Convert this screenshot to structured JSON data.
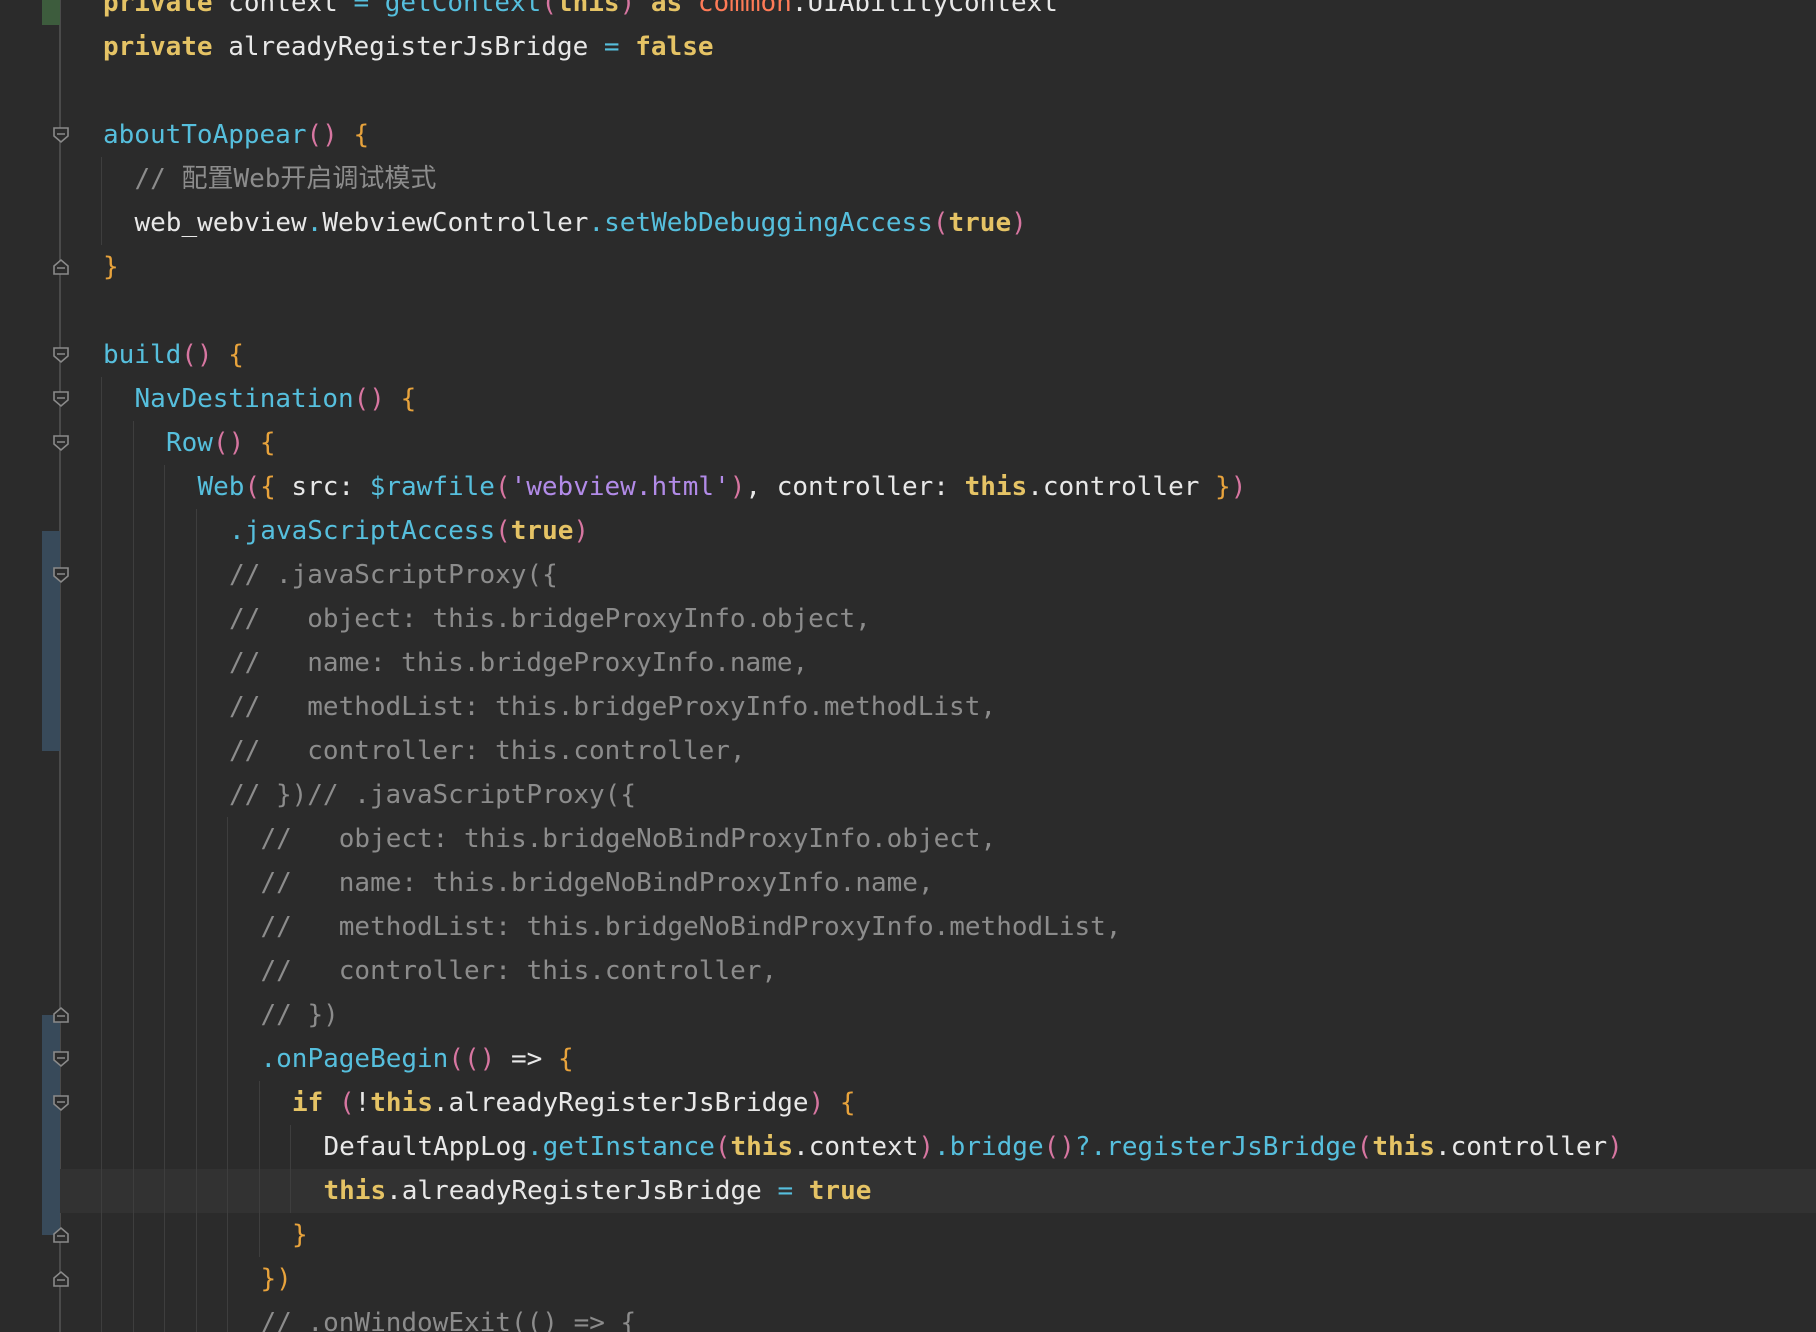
{
  "editor": {
    "lines": [
      {
        "indent": 0,
        "tokens": [
          {
            "t": "private",
            "c": "keyword"
          },
          {
            "t": " context ",
            "c": "default"
          },
          {
            "t": "=",
            "c": "op"
          },
          {
            "t": " getContext",
            "c": "fn"
          },
          {
            "t": "(",
            "c": "paren"
          },
          {
            "t": "this",
            "c": "keyword"
          },
          {
            "t": ")",
            "c": "paren"
          },
          {
            "t": " as ",
            "c": "keyword"
          },
          {
            "t": "common",
            "c": "type"
          },
          {
            "t": ".UIAbilityContext",
            "c": "default"
          }
        ]
      },
      {
        "indent": 0,
        "tokens": [
          {
            "t": "private",
            "c": "keyword"
          },
          {
            "t": " alreadyRegisterJsBridge ",
            "c": "default"
          },
          {
            "t": "=",
            "c": "op"
          },
          {
            "t": " false",
            "c": "keyword"
          }
        ]
      },
      {
        "indent": 0,
        "tokens": []
      },
      {
        "indent": 0,
        "tokens": [
          {
            "t": "aboutToAppear",
            "c": "fn"
          },
          {
            "t": "()",
            "c": "paren"
          },
          {
            "t": " {",
            "c": "brace"
          }
        ]
      },
      {
        "indent": 1,
        "tokens": [
          {
            "t": "// 配置Web开启调试模式",
            "c": "comment"
          }
        ]
      },
      {
        "indent": 1,
        "tokens": [
          {
            "t": "web_webview",
            "c": "default"
          },
          {
            "t": ".",
            "c": "dot"
          },
          {
            "t": "WebviewController",
            "c": "default"
          },
          {
            "t": ".",
            "c": "dot"
          },
          {
            "t": "setWebDebuggingAccess",
            "c": "fn"
          },
          {
            "t": "(",
            "c": "paren"
          },
          {
            "t": "true",
            "c": "keyword"
          },
          {
            "t": ")",
            "c": "paren"
          }
        ]
      },
      {
        "indent": 0,
        "tokens": [
          {
            "t": "}",
            "c": "brace"
          }
        ]
      },
      {
        "indent": 0,
        "tokens": []
      },
      {
        "indent": 0,
        "tokens": [
          {
            "t": "build",
            "c": "fn"
          },
          {
            "t": "()",
            "c": "paren"
          },
          {
            "t": " {",
            "c": "brace"
          }
        ]
      },
      {
        "indent": 1,
        "tokens": [
          {
            "t": "NavDestination",
            "c": "fn"
          },
          {
            "t": "()",
            "c": "paren"
          },
          {
            "t": " {",
            "c": "brace"
          }
        ]
      },
      {
        "indent": 2,
        "tokens": [
          {
            "t": "Row",
            "c": "fn"
          },
          {
            "t": "()",
            "c": "paren"
          },
          {
            "t": " {",
            "c": "brace"
          }
        ]
      },
      {
        "indent": 3,
        "tokens": [
          {
            "t": "Web",
            "c": "fn"
          },
          {
            "t": "(",
            "c": "paren"
          },
          {
            "t": "{",
            "c": "brace"
          },
          {
            "t": " src: ",
            "c": "default"
          },
          {
            "t": "$rawfile",
            "c": "fn"
          },
          {
            "t": "(",
            "c": "paren"
          },
          {
            "t": "'webview.html'",
            "c": "string"
          },
          {
            "t": ")",
            "c": "paren"
          },
          {
            "t": ", controller: ",
            "c": "default"
          },
          {
            "t": "this",
            "c": "keyword"
          },
          {
            "t": ".controller ",
            "c": "default"
          },
          {
            "t": "}",
            "c": "brace"
          },
          {
            "t": ")",
            "c": "paren"
          }
        ]
      },
      {
        "indent": 4,
        "tokens": [
          {
            "t": ".javaScriptAccess",
            "c": "fn"
          },
          {
            "t": "(",
            "c": "paren"
          },
          {
            "t": "true",
            "c": "keyword"
          },
          {
            "t": ")",
            "c": "paren"
          }
        ]
      },
      {
        "indent": 4,
        "tokens": [
          {
            "t": "// .javaScriptProxy({",
            "c": "comment"
          }
        ]
      },
      {
        "indent": 4,
        "tokens": [
          {
            "t": "//   object: this.bridgeProxyInfo.object,",
            "c": "comment"
          }
        ]
      },
      {
        "indent": 4,
        "tokens": [
          {
            "t": "//   name: this.bridgeProxyInfo.name,",
            "c": "comment"
          }
        ]
      },
      {
        "indent": 4,
        "tokens": [
          {
            "t": "//   methodList: this.bridgeProxyInfo.methodList,",
            "c": "comment"
          }
        ]
      },
      {
        "indent": 4,
        "tokens": [
          {
            "t": "//   controller: this.controller,",
            "c": "comment"
          }
        ]
      },
      {
        "indent": 4,
        "tokens": [
          {
            "t": "// })// .javaScriptProxy({",
            "c": "comment"
          }
        ]
      },
      {
        "indent": 5,
        "tokens": [
          {
            "t": "//   object: this.bridgeNoBindProxyInfo.object,",
            "c": "comment"
          }
        ]
      },
      {
        "indent": 5,
        "tokens": [
          {
            "t": "//   name: this.bridgeNoBindProxyInfo.name,",
            "c": "comment"
          }
        ]
      },
      {
        "indent": 5,
        "tokens": [
          {
            "t": "//   methodList: this.bridgeNoBindProxyInfo.methodList,",
            "c": "comment"
          }
        ]
      },
      {
        "indent": 5,
        "tokens": [
          {
            "t": "//   controller: this.controller,",
            "c": "comment"
          }
        ]
      },
      {
        "indent": 5,
        "tokens": [
          {
            "t": "// })",
            "c": "comment"
          }
        ]
      },
      {
        "indent": 5,
        "tokens": [
          {
            "t": ".onPageBegin",
            "c": "fn"
          },
          {
            "t": "(()",
            "c": "paren"
          },
          {
            "t": " => ",
            "c": "default"
          },
          {
            "t": "{",
            "c": "brace"
          }
        ]
      },
      {
        "indent": 6,
        "tokens": [
          {
            "t": "if",
            "c": "keyword"
          },
          {
            "t": " (",
            "c": "paren"
          },
          {
            "t": "!",
            "c": "default"
          },
          {
            "t": "this",
            "c": "keyword"
          },
          {
            "t": ".alreadyRegisterJsBridge",
            "c": "default"
          },
          {
            "t": ")",
            "c": "paren"
          },
          {
            "t": " {",
            "c": "brace"
          }
        ]
      },
      {
        "indent": 7,
        "tokens": [
          {
            "t": "DefaultAppLog",
            "c": "default"
          },
          {
            "t": ".",
            "c": "dot"
          },
          {
            "t": "getInstance",
            "c": "fn"
          },
          {
            "t": "(",
            "c": "paren"
          },
          {
            "t": "this",
            "c": "keyword"
          },
          {
            "t": ".context",
            "c": "default"
          },
          {
            "t": ")",
            "c": "paren"
          },
          {
            "t": ".",
            "c": "dot"
          },
          {
            "t": "bridge",
            "c": "fn"
          },
          {
            "t": "()",
            "c": "paren"
          },
          {
            "t": "?.",
            "c": "dot"
          },
          {
            "t": "registerJsBridge",
            "c": "fn"
          },
          {
            "t": "(",
            "c": "paren"
          },
          {
            "t": "this",
            "c": "keyword"
          },
          {
            "t": ".controller",
            "c": "default"
          },
          {
            "t": ")",
            "c": "paren"
          }
        ]
      },
      {
        "indent": 7,
        "tokens": [
          {
            "t": "this",
            "c": "keyword"
          },
          {
            "t": ".alreadyRegisterJsBridge ",
            "c": "default"
          },
          {
            "t": "=",
            "c": "op"
          },
          {
            "t": " true",
            "c": "keyword"
          }
        ]
      },
      {
        "indent": 6,
        "tokens": [
          {
            "t": "}",
            "c": "brace"
          }
        ]
      },
      {
        "indent": 5,
        "tokens": [
          {
            "t": "})",
            "c": "brace"
          }
        ]
      },
      {
        "indent": 5,
        "tokens": [
          {
            "t": "// .onWindowExit(() => {",
            "c": "comment"
          }
        ]
      }
    ]
  }
}
